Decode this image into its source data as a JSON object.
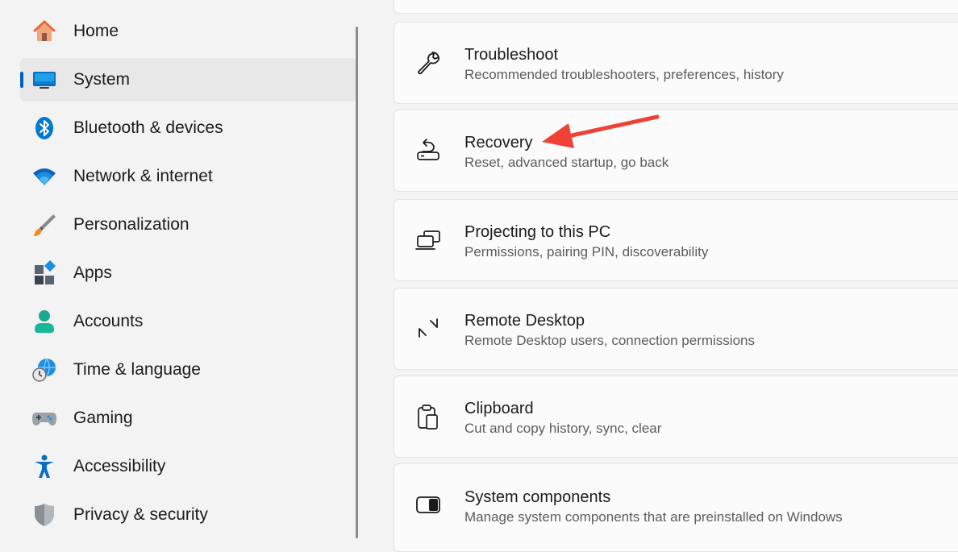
{
  "sidebar": {
    "items": [
      {
        "label": "Home",
        "icon": "home-icon"
      },
      {
        "label": "System",
        "icon": "system-monitor-icon",
        "selected": true
      },
      {
        "label": "Bluetooth & devices",
        "icon": "bluetooth-icon"
      },
      {
        "label": "Network & internet",
        "icon": "wifi-icon"
      },
      {
        "label": "Personalization",
        "icon": "paintbrush-icon"
      },
      {
        "label": "Apps",
        "icon": "apps-icon"
      },
      {
        "label": "Accounts",
        "icon": "person-icon"
      },
      {
        "label": "Time & language",
        "icon": "globe-clock-icon"
      },
      {
        "label": "Gaming",
        "icon": "gamepad-icon"
      },
      {
        "label": "Accessibility",
        "icon": "accessibility-icon"
      },
      {
        "label": "Privacy & security",
        "icon": "shield-icon"
      }
    ]
  },
  "main": {
    "cards": [
      {
        "title": "Troubleshoot",
        "subtitle": "Recommended troubleshooters, preferences, history",
        "icon": "wrench-icon"
      },
      {
        "title": "Recovery",
        "subtitle": "Reset, advanced startup, go back",
        "icon": "recovery-icon"
      },
      {
        "title": "Projecting to this PC",
        "subtitle": "Permissions, pairing PIN, discoverability",
        "icon": "projecting-icon"
      },
      {
        "title": "Remote Desktop",
        "subtitle": "Remote Desktop users, connection permissions",
        "icon": "remote-desktop-icon"
      },
      {
        "title": "Clipboard",
        "subtitle": "Cut and copy history, sync, clear",
        "icon": "clipboard-icon"
      },
      {
        "title": "System components",
        "subtitle": "Manage system components that are preinstalled on Windows",
        "icon": "system-components-icon"
      }
    ]
  },
  "colors": {
    "accent": "#005fb8",
    "annotation_arrow": "#ef4136",
    "background": "#f3f3f3",
    "card": "#fbfbfb"
  }
}
